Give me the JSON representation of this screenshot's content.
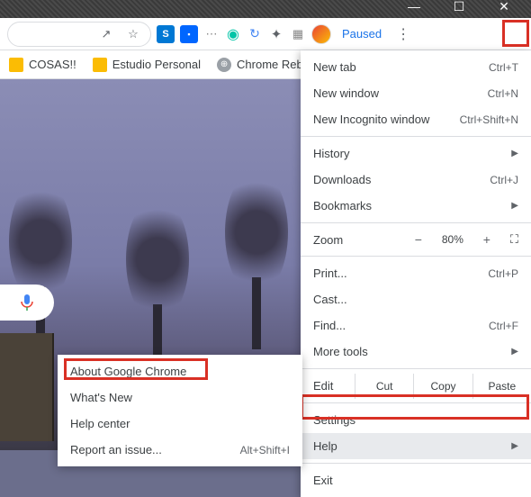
{
  "window": {
    "min": "—",
    "max": "☐",
    "close": "✕"
  },
  "toolbar": {
    "paused": "Paused"
  },
  "bookmarks": [
    {
      "label": "COSAS!!",
      "color": "#fbbc04"
    },
    {
      "label": "Estudio Personal",
      "color": "#fbbc04"
    },
    {
      "label": "Chrome Reboot",
      "color": "#9aa0a6"
    }
  ],
  "menu": {
    "new_tab": {
      "l": "New tab",
      "s": "Ctrl+T"
    },
    "new_window": {
      "l": "New window",
      "s": "Ctrl+N"
    },
    "incognito": {
      "l": "New Incognito window",
      "s": "Ctrl+Shift+N"
    },
    "history": {
      "l": "History"
    },
    "downloads": {
      "l": "Downloads",
      "s": "Ctrl+J"
    },
    "bookmarks": {
      "l": "Bookmarks"
    },
    "zoom": {
      "l": "Zoom",
      "v": "80%"
    },
    "print": {
      "l": "Print...",
      "s": "Ctrl+P"
    },
    "cast": {
      "l": "Cast..."
    },
    "find": {
      "l": "Find...",
      "s": "Ctrl+F"
    },
    "more_tools": {
      "l": "More tools"
    },
    "edit": {
      "l": "Edit",
      "cut": "Cut",
      "copy": "Copy",
      "paste": "Paste"
    },
    "settings": {
      "l": "Settings"
    },
    "help": {
      "l": "Help"
    },
    "exit": {
      "l": "Exit"
    }
  },
  "help_sub": {
    "about": {
      "l": "About Google Chrome"
    },
    "whats_new": {
      "l": "What's New"
    },
    "help_center": {
      "l": "Help center"
    },
    "report": {
      "l": "Report an issue...",
      "s": "Alt+Shift+I"
    }
  }
}
